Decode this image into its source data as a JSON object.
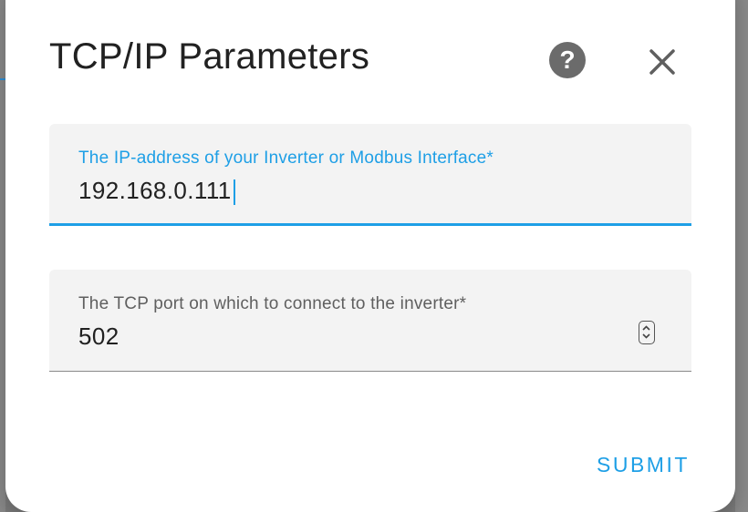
{
  "dialog": {
    "title": "TCP/IP Parameters",
    "help_icon": "help-circle-icon",
    "close_icon": "close-icon",
    "submit_label": "SUBMIT"
  },
  "fields": {
    "ip": {
      "label": "The IP-address of your Inverter or Modbus Interface*",
      "value": "192.168.0.111"
    },
    "port": {
      "label": "The TCP port on which to connect to the inverter*",
      "value": "502"
    }
  },
  "colors": {
    "accent": "#1e9fe6",
    "text": "#212121",
    "field_bg": "#f3f3f3",
    "help_bg": "#6b6b6b"
  }
}
